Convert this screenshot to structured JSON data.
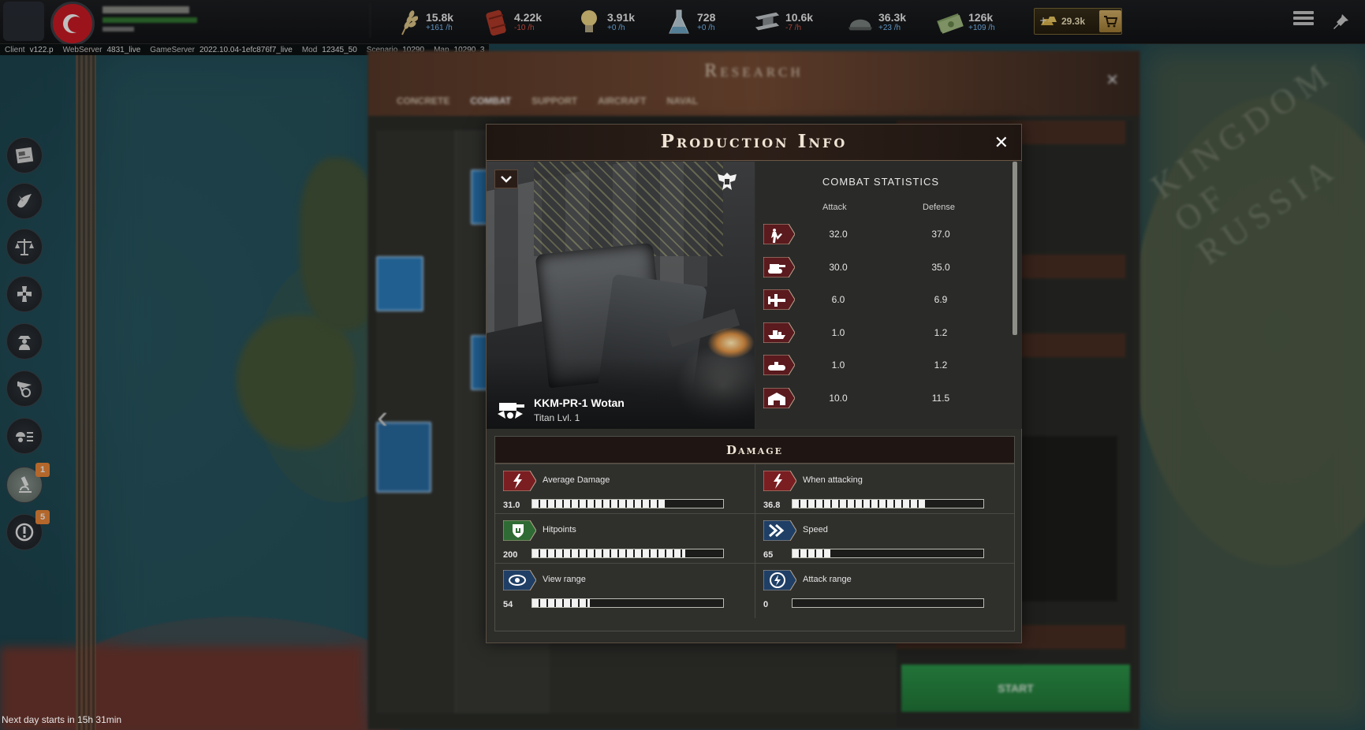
{
  "top_bar": {
    "resources": [
      {
        "name": "food",
        "icon": "wheat-icon",
        "value": "15.8k",
        "rate": "+161 /h",
        "rate_sign": "pos"
      },
      {
        "name": "oil",
        "icon": "oil-barrel-icon",
        "value": "4.22k",
        "rate": "-10 /h",
        "rate_sign": "neg"
      },
      {
        "name": "electricity",
        "icon": "lightbulb-icon",
        "value": "3.91k",
        "rate": "+0 /h",
        "rate_sign": "pos"
      },
      {
        "name": "chemicals",
        "icon": "flask-icon",
        "value": "728",
        "rate": "+0 /h",
        "rate_sign": "pos"
      },
      {
        "name": "steel",
        "icon": "steel-beam-icon",
        "value": "10.6k",
        "rate": "-7 /h",
        "rate_sign": "neg"
      },
      {
        "name": "manpower",
        "icon": "helmet-icon",
        "value": "36.3k",
        "rate": "+23 /h",
        "rate_sign": "pos"
      },
      {
        "name": "money",
        "icon": "cash-icon",
        "value": "126k",
        "rate": "+109 /h",
        "rate_sign": "pos"
      }
    ],
    "gold": "29.3k"
  },
  "info_line": [
    {
      "key": "Client",
      "value": "v122.p"
    },
    {
      "key": "WebServer",
      "value": "4831_live"
    },
    {
      "key": "GameServer",
      "value": "2022.10.04-1efc876f7_live"
    },
    {
      "key": "Mod",
      "value": "12345_50"
    },
    {
      "key": "Scenario",
      "value": "10290"
    },
    {
      "key": "Map",
      "value": "10290_3"
    }
  ],
  "sidebar": {
    "items": [
      {
        "name": "newspaper",
        "icon": "newspaper-icon"
      },
      {
        "name": "diplomacy",
        "icon": "dove-icon"
      },
      {
        "name": "trade",
        "icon": "scales-icon"
      },
      {
        "name": "army",
        "icon": "military-cross-icon"
      },
      {
        "name": "spy",
        "icon": "spy-icon"
      },
      {
        "name": "provinces",
        "icon": "flag-pin-icon"
      },
      {
        "name": "units",
        "icon": "soldier-list-icon"
      },
      {
        "name": "research",
        "icon": "microscope-icon",
        "badge": "1"
      },
      {
        "name": "alerts",
        "icon": "alert-icon",
        "badge": "5"
      }
    ]
  },
  "next_day": "Next day starts in 15h 31min",
  "research_panel": {
    "title": "Research",
    "tabs": [
      "CONCRETE",
      "COMBAT",
      "SUPPORT",
      "AIRCRAFT",
      "NAVAL"
    ],
    "start_label": "START"
  },
  "modal": {
    "title": "Production Info",
    "unit_name": "KKM-PR-1 Wotan",
    "unit_level": "Titan Lvl. 1",
    "stats_title": "COMBAT STATISTICS",
    "col_attack": "Attack",
    "col_defense": "Defense",
    "combat_rows": [
      {
        "target": "infantry",
        "icon": "infantry-icon",
        "attack": "32.0",
        "defense": "37.0"
      },
      {
        "target": "armored",
        "icon": "tank-icon",
        "attack": "30.0",
        "defense": "35.0"
      },
      {
        "target": "airplane",
        "icon": "airplane-icon",
        "attack": "6.0",
        "defense": "6.9"
      },
      {
        "target": "ship",
        "icon": "ship-icon",
        "attack": "1.0",
        "defense": "1.2"
      },
      {
        "target": "submarine",
        "icon": "submarine-icon",
        "attack": "1.0",
        "defense": "1.2"
      },
      {
        "target": "building",
        "icon": "building-icon",
        "attack": "10.0",
        "defense": "11.5"
      }
    ],
    "damage_title": "Damage",
    "damage_stats": [
      {
        "label": "Average Damage",
        "icon": "lightning-icon",
        "icon_color": "#7a1e22",
        "value": "31.0",
        "fill": 0.7
      },
      {
        "label": "When attacking",
        "icon": "lightning-icon",
        "icon_color": "#7a1e22",
        "value": "36.8",
        "fill": 0.7
      },
      {
        "label": "Hitpoints",
        "icon": "shield-icon",
        "icon_color": "#2f6b34",
        "value": "200",
        "fill": 0.8
      },
      {
        "label": "Speed",
        "icon": "speed-icon",
        "icon_color": "#1f3f66",
        "value": "65",
        "fill": 0.2
      },
      {
        "label": "View range",
        "icon": "eye-icon",
        "icon_color": "#1f3f66",
        "value": "54",
        "fill": 0.3
      },
      {
        "label": "Attack range",
        "icon": "range-icon",
        "icon_color": "#1f3f66",
        "value": "0",
        "fill": 0
      }
    ]
  }
}
